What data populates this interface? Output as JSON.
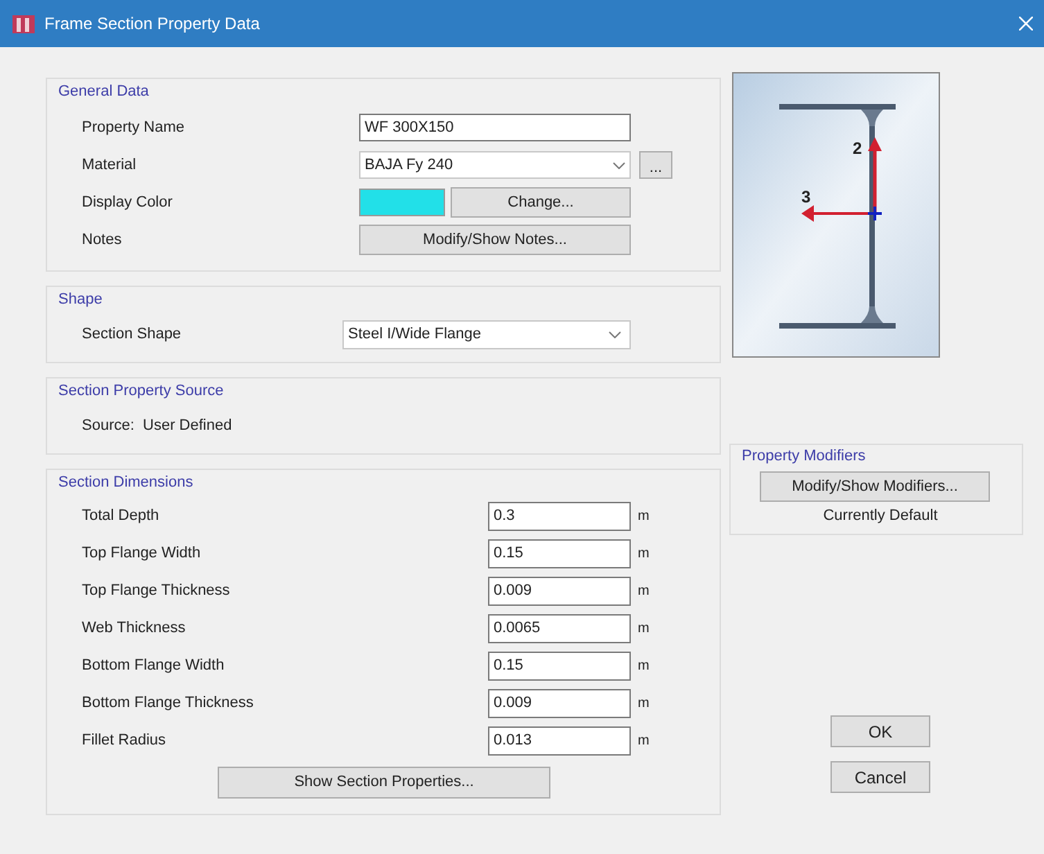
{
  "window": {
    "title": "Frame Section Property Data"
  },
  "general_data": {
    "title": "General Data",
    "property_name": {
      "label": "Property Name",
      "value": "WF 300X150"
    },
    "material": {
      "label": "Material",
      "value": "BAJA Fy 240",
      "more_button": "..."
    },
    "display_color": {
      "label": "Display Color",
      "color": "#22e0e8",
      "button": "Change..."
    },
    "notes": {
      "label": "Notes",
      "button": "Modify/Show Notes..."
    }
  },
  "shape": {
    "title": "Shape",
    "label": "Section Shape",
    "value": "Steel I/Wide Flange"
  },
  "source": {
    "title": "Section Property Source",
    "text": "Source:  User Defined"
  },
  "dimensions": {
    "title": "Section Dimensions",
    "rows": [
      {
        "label": "Total Depth",
        "value": "0.3",
        "unit": "m"
      },
      {
        "label": "Top Flange Width",
        "value": "0.15",
        "unit": "m"
      },
      {
        "label": "Top Flange Thickness",
        "value": "0.009",
        "unit": "m"
      },
      {
        "label": "Web Thickness",
        "value": "0.0065",
        "unit": "m"
      },
      {
        "label": "Bottom Flange Width",
        "value": "0.15",
        "unit": "m"
      },
      {
        "label": "Bottom Flange Thickness",
        "value": "0.009",
        "unit": "m"
      },
      {
        "label": "Fillet Radius",
        "value": "0.013",
        "unit": "m"
      }
    ],
    "button": "Show Section Properties..."
  },
  "preview": {
    "axis_labels": [
      "2",
      "3"
    ]
  },
  "modifiers": {
    "title": "Property Modifiers",
    "button": "Modify/Show Modifiers...",
    "status": "Currently Default"
  },
  "buttons": [
    "OK",
    "Cancel"
  ]
}
